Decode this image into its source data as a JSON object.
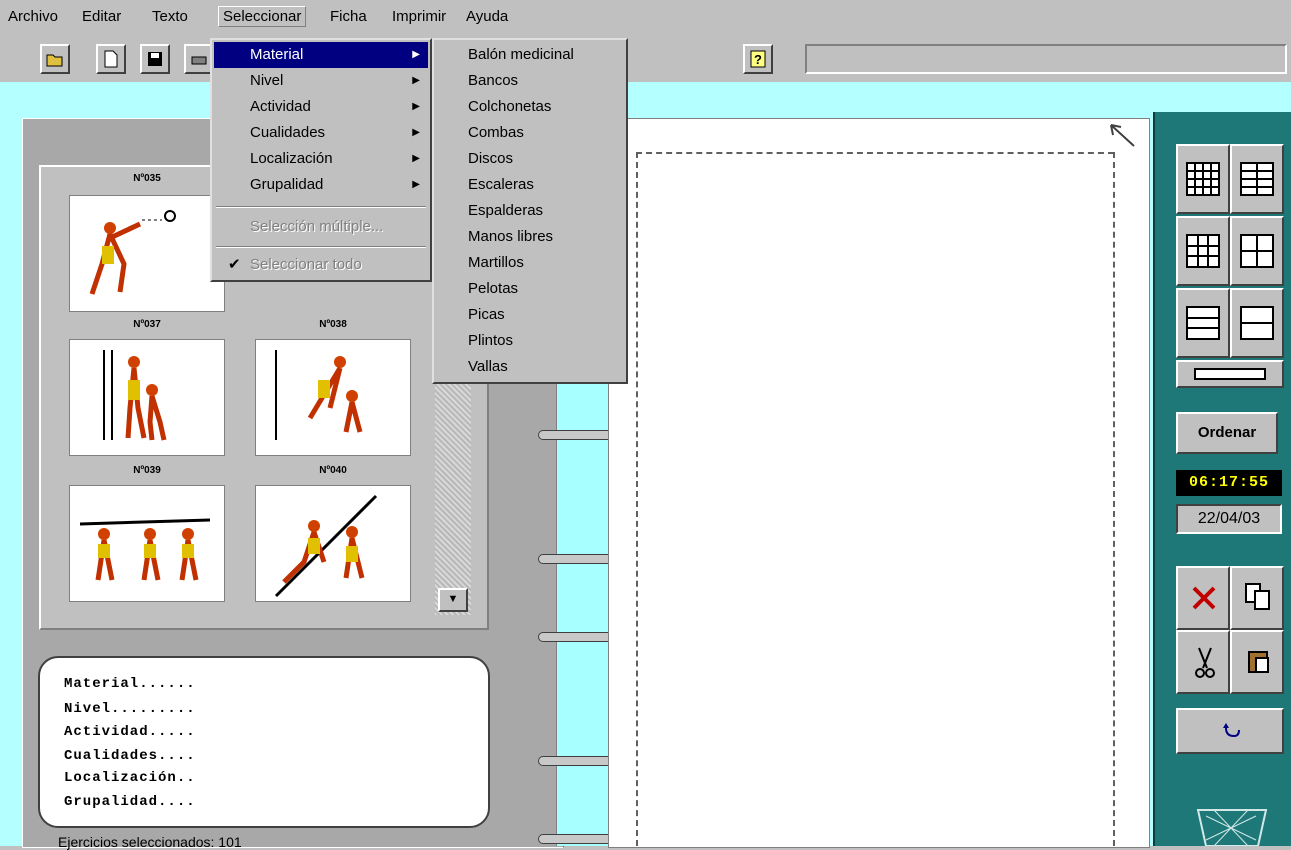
{
  "menubar": {
    "items": [
      "Archivo",
      "Editar",
      "Texto",
      "Seleccionar",
      "Ficha",
      "Imprimir",
      "Ayuda"
    ]
  },
  "select_menu": {
    "items": [
      {
        "label": "Material",
        "submenu": true
      },
      {
        "label": "Nivel",
        "submenu": true
      },
      {
        "label": "Actividad",
        "submenu": true
      },
      {
        "label": "Cualidades",
        "submenu": true
      },
      {
        "label": "Localización",
        "submenu": true
      },
      {
        "label": "Grupalidad",
        "submenu": true
      }
    ],
    "multi_select": "Selección múltiple...",
    "select_all": "Seleccionar todo",
    "check_mark": "✔"
  },
  "material_submenu": {
    "items": [
      "Balón medicinal",
      "Bancos",
      "Colchonetas",
      "Combas",
      "Discos",
      "Escaleras",
      "Espalderas",
      "Manos libres",
      "Martillos",
      "Pelotas",
      "Picas",
      "Plintos",
      "Vallas"
    ]
  },
  "thumbnails": [
    {
      "label": "Nº035"
    },
    {
      "label": ""
    },
    {
      "label": "Nº037"
    },
    {
      "label": "Nº038"
    },
    {
      "label": "Nº039"
    },
    {
      "label": "Nº040"
    }
  ],
  "info": {
    "rows": [
      "Material......",
      "Nivel.........",
      "Actividad.....",
      "Cualidades....",
      "Localización..",
      "Grupalidad...."
    ]
  },
  "status": {
    "bottom_text": "Ejercicios seleccionados: 101"
  },
  "right_panel": {
    "ordenar": "Ordenar",
    "clock": "06:17:55",
    "date": "22/04/03"
  },
  "colors": {
    "menu_highlight": "#000080",
    "cyan": "#b4ffff",
    "teal": "#1e7878"
  }
}
